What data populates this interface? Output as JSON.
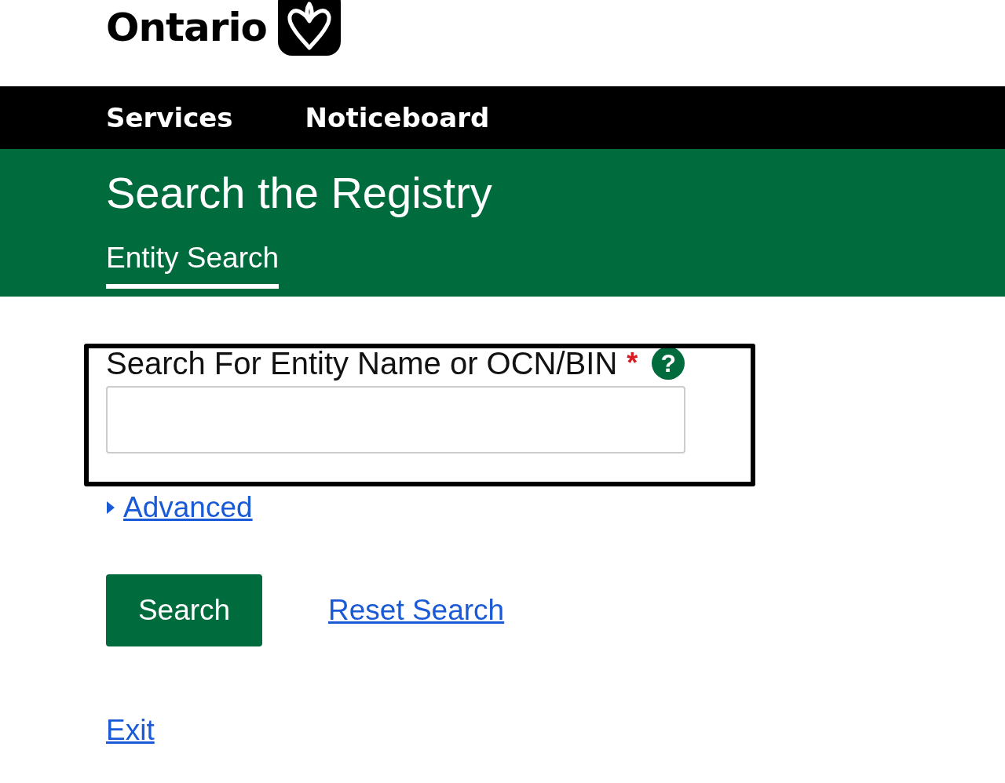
{
  "header": {
    "logo_text": "Ontario"
  },
  "nav": [
    {
      "label": "Services"
    },
    {
      "label": "Noticeboard"
    }
  ],
  "page_title": "Search the Registry",
  "tabs": [
    {
      "label": "Entity Search",
      "selected": true
    }
  ],
  "search": {
    "label": "Search For Entity Name or OCN/BIN",
    "required_mark": "*",
    "help": "?",
    "advanced": {
      "label": "Advanced",
      "expanded": false
    }
  },
  "buttons": {
    "search": "Search",
    "reset": "Reset Search"
  },
  "exit_link": "Exit"
}
